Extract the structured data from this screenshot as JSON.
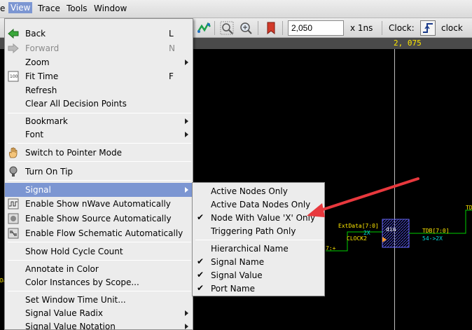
{
  "menubar": {
    "items": [
      {
        "label": "e"
      },
      {
        "label": "View"
      },
      {
        "label": "Trace"
      },
      {
        "label": "Tools"
      },
      {
        "label": "Window"
      }
    ]
  },
  "toolbar": {
    "time_value": "2,050",
    "time_unit": "x 1ns",
    "clock_label": "Clock:",
    "clock_value": "clock"
  },
  "wave": {
    "cursor_time": "2, 075",
    "signals": {
      "extdata": "ExtData[7:0]",
      "two_x": "2X",
      "clock2": "CLOCK2",
      "block": "din",
      "tdb": "TDB[7:0]",
      "tdb_val": "54->2X",
      "left_val": "7:+",
      "right_top": "TD"
    },
    "left_fragment": "Da"
  },
  "view_menu": {
    "items": [
      {
        "label": "Back",
        "shortcut": "L",
        "icon": "back-arrow-icon",
        "enabled": true
      },
      {
        "label": "Forward",
        "shortcut": "N",
        "icon": "forward-arrow-icon",
        "enabled": false
      },
      {
        "label": "Zoom",
        "submenu": true,
        "enabled": true
      },
      {
        "label": "Fit Time",
        "shortcut": "F",
        "icon": "fit-100-icon",
        "enabled": true
      },
      {
        "label": "Refresh",
        "enabled": true
      },
      {
        "label": "Clear All Decision Points",
        "enabled": true
      },
      {
        "label": "Bookmark",
        "submenu": true,
        "enabled": true
      },
      {
        "label": "Font",
        "submenu": true,
        "enabled": true
      },
      {
        "label": "Switch to Pointer Mode",
        "icon": "hand-pointer-icon",
        "enabled": true
      },
      {
        "label": "Turn On Tip",
        "icon": "lightbulb-icon",
        "enabled": true
      },
      {
        "label": "Signal",
        "submenu": true,
        "highlighted": true,
        "enabled": true
      },
      {
        "label": "Enable Show nWave Automatically",
        "icon": "nwave-icon",
        "enabled": true
      },
      {
        "label": "Enable Show Source Automatically",
        "icon": "source-icon",
        "enabled": true
      },
      {
        "label": "Enable Flow Schematic Automatically",
        "icon": "flow-schematic-icon",
        "enabled": true
      },
      {
        "label": "Show Hold Cycle Count",
        "enabled": true
      },
      {
        "label": "Annotate in Color",
        "enabled": true
      },
      {
        "label": "Color Instances by Scope...",
        "enabled": true
      },
      {
        "label": "Set Window Time Unit...",
        "enabled": true
      },
      {
        "label": "Signal Value Radix",
        "submenu": true,
        "enabled": true
      },
      {
        "label": "Signal Value Notation",
        "submenu": true,
        "enabled": true
      }
    ]
  },
  "signal_submenu": {
    "items": [
      {
        "label": "Active Nodes Only",
        "checked": false
      },
      {
        "label": "Active Data Nodes Only",
        "checked": false
      },
      {
        "label": "Node With Value 'X' Only",
        "checked": true
      },
      {
        "label": "Triggering Path Only",
        "checked": false
      },
      {
        "label": "Hierarchical Name",
        "checked": false
      },
      {
        "label": "Signal Name",
        "checked": true
      },
      {
        "label": "Signal Value",
        "checked": true
      },
      {
        "label": "Port Name",
        "checked": true
      }
    ]
  },
  "annotation": {
    "color": "#e8383d"
  }
}
